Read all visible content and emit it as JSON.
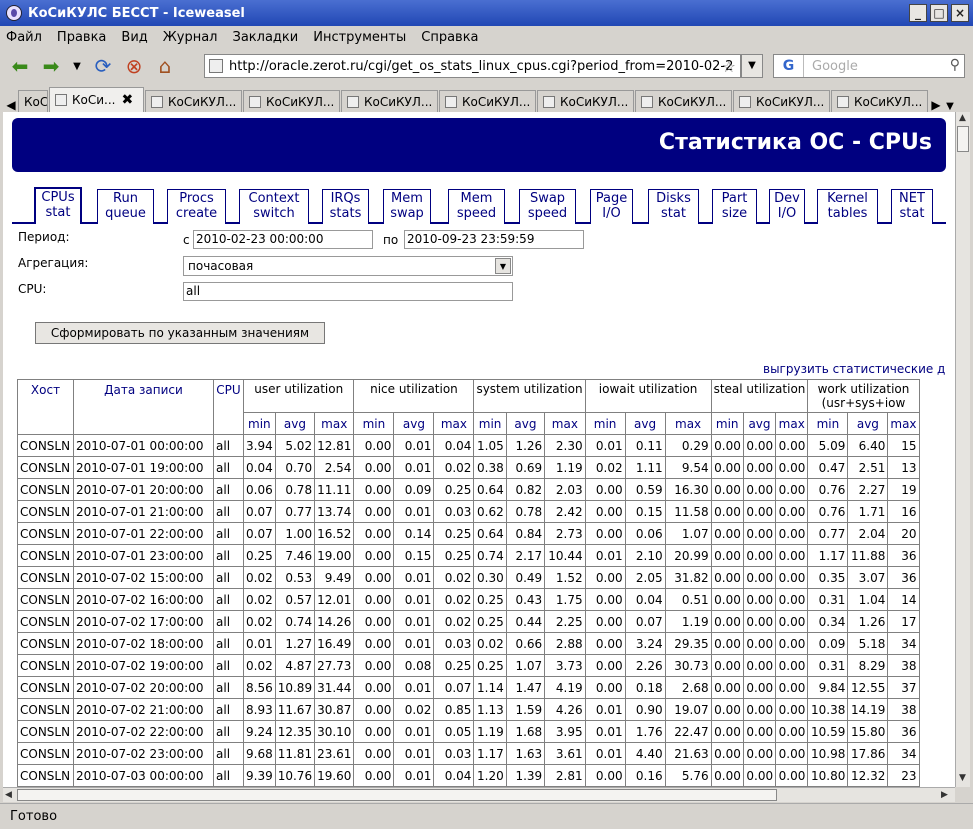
{
  "window": {
    "title": "КоСиКУЛС БЕССТ - Iceweasel"
  },
  "menu": [
    "Файл",
    "Правка",
    "Вид",
    "Журнал",
    "Закладки",
    "Инструменты",
    "Справка"
  ],
  "nav": {
    "url": "http://oracle.zerot.ru/cgi/get_os_stats_linux_cpus.cgi?period_from=2010-02-2",
    "search_placeholder": "Google"
  },
  "tabs": [
    "КоСиКУЛ...",
    "КоСи...",
    "КоСиКУЛ...",
    "КоСиКУЛ...",
    "КоСиКУЛ...",
    "КоСиКУЛ...",
    "КоСиКУЛ...",
    "КоСиКУЛ...",
    "КоСиКУЛ...",
    "КоСиКУЛ..."
  ],
  "page": {
    "banner": "Статистика ОС - CPUs",
    "stat_tabs": [
      {
        "l1": "CPUs",
        "l2": "stat"
      },
      {
        "l1": "Run",
        "l2": "queue"
      },
      {
        "l1": "Procs",
        "l2": "create"
      },
      {
        "l1": "Context",
        "l2": "switch"
      },
      {
        "l1": "IRQs",
        "l2": "stats"
      },
      {
        "l1": "Mem",
        "l2": "swap"
      },
      {
        "l1": "Mem",
        "l2": "speed"
      },
      {
        "l1": "Swap",
        "l2": "speed"
      },
      {
        "l1": "Page",
        "l2": "I/O"
      },
      {
        "l1": "Disks",
        "l2": "stat"
      },
      {
        "l1": "Part",
        "l2": "size"
      },
      {
        "l1": "Dev",
        "l2": "I/O"
      },
      {
        "l1": "Kernel",
        "l2": "tables"
      },
      {
        "l1": "NET",
        "l2": "stat"
      }
    ],
    "form": {
      "period_label": "Период:",
      "from_label": "с",
      "from_value": "2010-02-23 00:00:00",
      "to_label": "по",
      "to_value": "2010-09-23 23:59:59",
      "agg_label": "Агрегация:",
      "agg_value": "почасовая",
      "cpu_label": "CPU:",
      "cpu_value": "all",
      "submit": "Сформировать по указанным значениям"
    },
    "export_link": "выгрузить статистические д"
  },
  "table": {
    "headers": {
      "host": "Хост",
      "date": "Дата записи",
      "cpu": "CPU"
    },
    "groups": [
      "user utilization",
      "nice utilization",
      "system utilization",
      "iowait utilization",
      "steal utilization",
      "work utilization",
      "(usr+sys+iow"
    ],
    "sub": [
      "min",
      "avg",
      "max"
    ],
    "rows": [
      [
        "CONSLN",
        "2010-07-01 00:00:00",
        "all",
        "3.94",
        "5.02",
        "12.81",
        "0.00",
        "0.01",
        "0.04",
        "1.05",
        "1.26",
        "2.30",
        "0.01",
        "0.11",
        "0.29",
        "0.00",
        "0.00",
        "0.00",
        "5.09",
        "6.40",
        "15"
      ],
      [
        "CONSLN",
        "2010-07-01 19:00:00",
        "all",
        "0.04",
        "0.70",
        "2.54",
        "0.00",
        "0.01",
        "0.02",
        "0.38",
        "0.69",
        "1.19",
        "0.02",
        "1.11",
        "9.54",
        "0.00",
        "0.00",
        "0.00",
        "0.47",
        "2.51",
        "13"
      ],
      [
        "CONSLN",
        "2010-07-01 20:00:00",
        "all",
        "0.06",
        "0.78",
        "11.11",
        "0.00",
        "0.09",
        "0.25",
        "0.64",
        "0.82",
        "2.03",
        "0.00",
        "0.59",
        "16.30",
        "0.00",
        "0.00",
        "0.00",
        "0.76",
        "2.27",
        "19"
      ],
      [
        "CONSLN",
        "2010-07-01 21:00:00",
        "all",
        "0.07",
        "0.77",
        "13.74",
        "0.00",
        "0.01",
        "0.03",
        "0.62",
        "0.78",
        "2.42",
        "0.00",
        "0.15",
        "11.58",
        "0.00",
        "0.00",
        "0.00",
        "0.76",
        "1.71",
        "16"
      ],
      [
        "CONSLN",
        "2010-07-01 22:00:00",
        "all",
        "0.07",
        "1.00",
        "16.52",
        "0.00",
        "0.14",
        "0.25",
        "0.64",
        "0.84",
        "2.73",
        "0.00",
        "0.06",
        "1.07",
        "0.00",
        "0.00",
        "0.00",
        "0.77",
        "2.04",
        "20"
      ],
      [
        "CONSLN",
        "2010-07-01 23:00:00",
        "all",
        "0.25",
        "7.46",
        "19.00",
        "0.00",
        "0.15",
        "0.25",
        "0.74",
        "2.17",
        "10.44",
        "0.01",
        "2.10",
        "20.99",
        "0.00",
        "0.00",
        "0.00",
        "1.17",
        "11.88",
        "36"
      ],
      [
        "CONSLN",
        "2010-07-02 15:00:00",
        "all",
        "0.02",
        "0.53",
        "9.49",
        "0.00",
        "0.01",
        "0.02",
        "0.30",
        "0.49",
        "1.52",
        "0.00",
        "2.05",
        "31.82",
        "0.00",
        "0.00",
        "0.00",
        "0.35",
        "3.07",
        "36"
      ],
      [
        "CONSLN",
        "2010-07-02 16:00:00",
        "all",
        "0.02",
        "0.57",
        "12.01",
        "0.00",
        "0.01",
        "0.02",
        "0.25",
        "0.43",
        "1.75",
        "0.00",
        "0.04",
        "0.51",
        "0.00",
        "0.00",
        "0.00",
        "0.31",
        "1.04",
        "14"
      ],
      [
        "CONSLN",
        "2010-07-02 17:00:00",
        "all",
        "0.02",
        "0.74",
        "14.26",
        "0.00",
        "0.01",
        "0.02",
        "0.25",
        "0.44",
        "2.25",
        "0.00",
        "0.07",
        "1.19",
        "0.00",
        "0.00",
        "0.00",
        "0.34",
        "1.26",
        "17"
      ],
      [
        "CONSLN",
        "2010-07-02 18:00:00",
        "all",
        "0.01",
        "1.27",
        "16.49",
        "0.00",
        "0.01",
        "0.03",
        "0.02",
        "0.66",
        "2.88",
        "0.00",
        "3.24",
        "29.35",
        "0.00",
        "0.00",
        "0.00",
        "0.09",
        "5.18",
        "34"
      ],
      [
        "CONSLN",
        "2010-07-02 19:00:00",
        "all",
        "0.02",
        "4.87",
        "27.73",
        "0.00",
        "0.08",
        "0.25",
        "0.25",
        "1.07",
        "3.73",
        "0.00",
        "2.26",
        "30.73",
        "0.00",
        "0.00",
        "0.00",
        "0.31",
        "8.29",
        "38"
      ],
      [
        "CONSLN",
        "2010-07-02 20:00:00",
        "all",
        "8.56",
        "10.89",
        "31.44",
        "0.00",
        "0.01",
        "0.07",
        "1.14",
        "1.47",
        "4.19",
        "0.00",
        "0.18",
        "2.68",
        "0.00",
        "0.00",
        "0.00",
        "9.84",
        "12.55",
        "37"
      ],
      [
        "CONSLN",
        "2010-07-02 21:00:00",
        "all",
        "8.93",
        "11.67",
        "30.87",
        "0.00",
        "0.02",
        "0.85",
        "1.13",
        "1.59",
        "4.26",
        "0.01",
        "0.90",
        "19.07",
        "0.00",
        "0.00",
        "0.00",
        "10.38",
        "14.19",
        "38"
      ],
      [
        "CONSLN",
        "2010-07-02 22:00:00",
        "all",
        "9.24",
        "12.35",
        "30.10",
        "0.00",
        "0.01",
        "0.05",
        "1.19",
        "1.68",
        "3.95",
        "0.01",
        "1.76",
        "22.47",
        "0.00",
        "0.00",
        "0.00",
        "10.59",
        "15.80",
        "36"
      ],
      [
        "CONSLN",
        "2010-07-02 23:00:00",
        "all",
        "9.68",
        "11.81",
        "23.61",
        "0.00",
        "0.01",
        "0.03",
        "1.17",
        "1.63",
        "3.61",
        "0.01",
        "4.40",
        "21.63",
        "0.00",
        "0.00",
        "0.00",
        "10.98",
        "17.86",
        "34"
      ],
      [
        "CONSLN",
        "2010-07-03 00:00:00",
        "all",
        "9.39",
        "10.76",
        "19.60",
        "0.00",
        "0.01",
        "0.04",
        "1.20",
        "1.39",
        "2.81",
        "0.00",
        "0.16",
        "5.76",
        "0.00",
        "0.00",
        "0.00",
        "10.80",
        "12.32",
        "23"
      ]
    ]
  },
  "status": "Готово"
}
